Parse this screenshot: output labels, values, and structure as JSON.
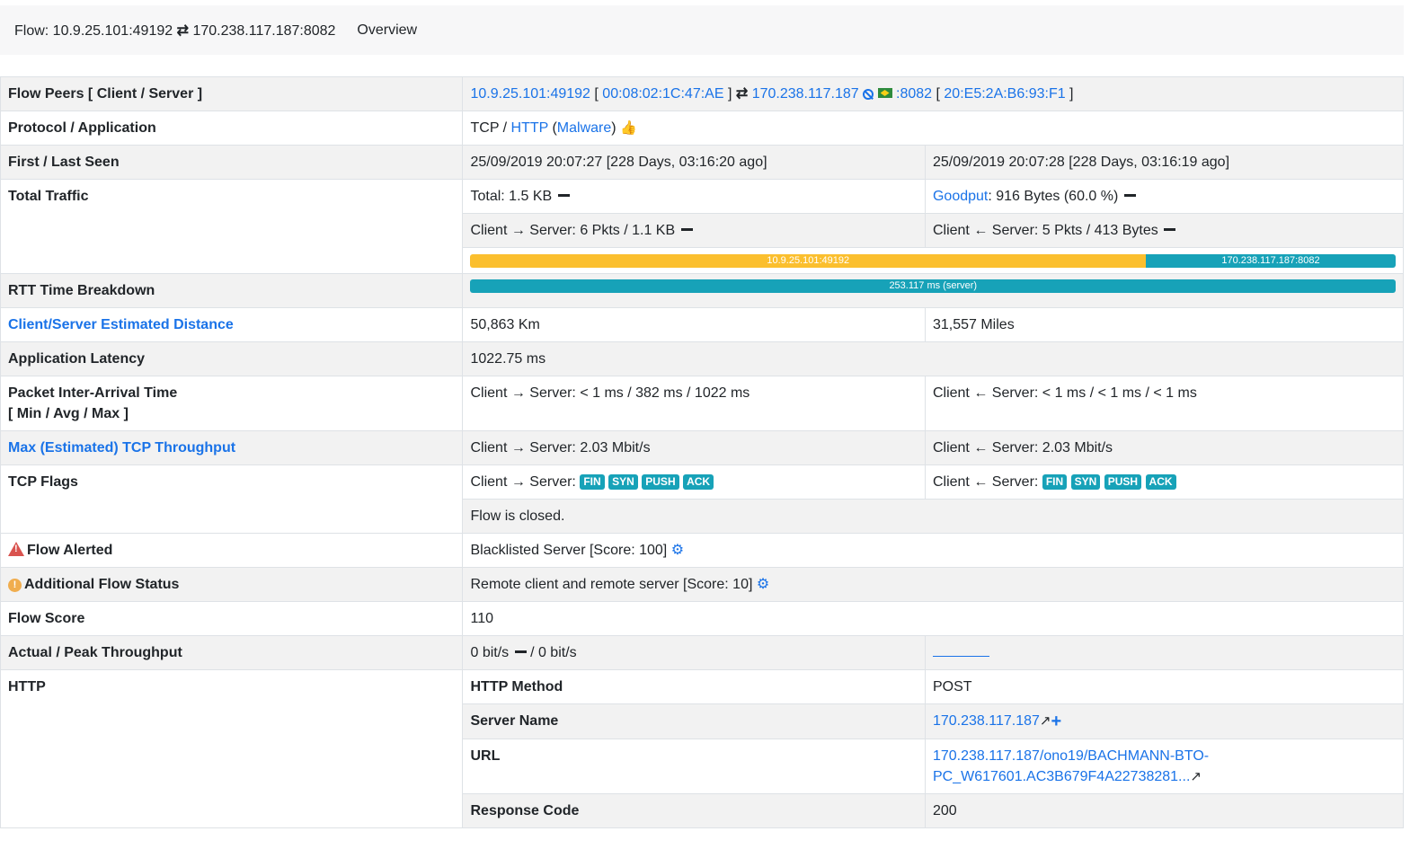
{
  "header": {
    "flow_prefix": "Flow: 10.9.25.101:49192",
    "flow_swap_icon": "⇄",
    "flow_suffix": "170.238.117.187:8082",
    "overview_tab": "Overview"
  },
  "rows": {
    "peers": {
      "label": "Flow Peers [ Client / Server ]",
      "client_ip": "10.9.25.101:49192",
      "client_mac": "00:08:02:1C:47:AE",
      "server_ip": "170.238.117.187",
      "server_port": ":8082",
      "server_mac": "20:E5:2A:B6:93:F1"
    },
    "protocol": {
      "label": "Protocol / Application",
      "proto": "TCP / ",
      "app": "HTTP",
      "category": "Malware"
    },
    "seen": {
      "label": "First / Last Seen",
      "first": "25/09/2019 20:07:27 [228 Days, 03:16:20 ago]",
      "last": "25/09/2019 20:07:28 [228 Days, 03:16:19 ago]"
    },
    "traffic": {
      "label": "Total Traffic",
      "total": "Total: 1.5 KB",
      "goodput_label": "Goodput",
      "goodput_value": ": 916 Bytes (60.0 %)",
      "c2s_prefix": "Client",
      "c2s_suffix": "Server: 6 Pkts / 1.1 KB",
      "s2c_prefix": "Client",
      "s2c_suffix": "Server: 5 Pkts / 413 Bytes",
      "bar_client_label": "10.9.25.101:49192",
      "bar_server_label": "170.238.117.187:8082",
      "bar_client_fraction": 0.73
    },
    "rtt": {
      "label": "RTT Time Breakdown",
      "bar_label": "253.117 ms (server)"
    },
    "distance": {
      "label": "Client/Server Estimated Distance",
      "km": "50,863 Km",
      "miles": "31,557 Miles"
    },
    "latency": {
      "label": "Application Latency",
      "value": "1022.75 ms"
    },
    "iat": {
      "label_line1": "Packet Inter-Arrival Time",
      "label_line2": "[ Min / Avg / Max ]",
      "c2s_prefix": "Client",
      "c2s_suffix": "Server: < 1 ms / 382 ms / 1022 ms",
      "s2c_prefix": "Client",
      "s2c_suffix": "Server: < 1 ms / < 1 ms / < 1 ms"
    },
    "throughput_est": {
      "label": "Max (Estimated) TCP Throughput",
      "c2s_prefix": "Client",
      "c2s_suffix": "Server: 2.03 Mbit/s",
      "s2c_prefix": "Client",
      "s2c_suffix": "Server: 2.03 Mbit/s"
    },
    "tcp_flags": {
      "label": "TCP Flags",
      "c2s_prefix": "Client",
      "c2s_suffix": "Server:",
      "s2c_prefix": "Client",
      "s2c_suffix": "Server:",
      "flags": [
        "FIN",
        "SYN",
        "PUSH",
        "ACK"
      ],
      "status": "Flow is closed."
    },
    "alerted": {
      "label": "Flow Alerted",
      "value": "Blacklisted Server [Score: 100]"
    },
    "additional": {
      "label": "Additional Flow Status",
      "value": "Remote client and remote server [Score: 10]"
    },
    "score": {
      "label": "Flow Score",
      "value": "110"
    },
    "actual_peak": {
      "label": "Actual / Peak Throughput",
      "actual": "0 bit/s",
      "peak": " / 0 bit/s"
    },
    "http": {
      "label": "HTTP",
      "method_label": "HTTP Method",
      "method_value": "POST",
      "server_label": "Server Name",
      "server_value": "170.238.117.187",
      "url_label": "URL",
      "url_line1": "170.238.117.187/ono19/BACHMANN-BTO-",
      "url_line2": "PC_W617601.AC3B679F4A22738281...",
      "code_label": "Response Code",
      "code_value": "200"
    }
  },
  "colors": {
    "link": "#1a73e8",
    "badge": "#17a2b8",
    "bar_client": "#fbbf2e",
    "bar_server": "#17a2b8",
    "alert": "#d9534f",
    "warning": "#f0ad4e"
  },
  "icons": [
    "swap-icon",
    "arrow-right-icon",
    "arrow-left-icon",
    "thumbs-up-icon",
    "cog-icon",
    "warning-triangle-icon",
    "exclamation-circle-icon",
    "blocked-icon",
    "flag-brazil-icon",
    "external-link-icon",
    "plus-icon",
    "minus-icon"
  ]
}
